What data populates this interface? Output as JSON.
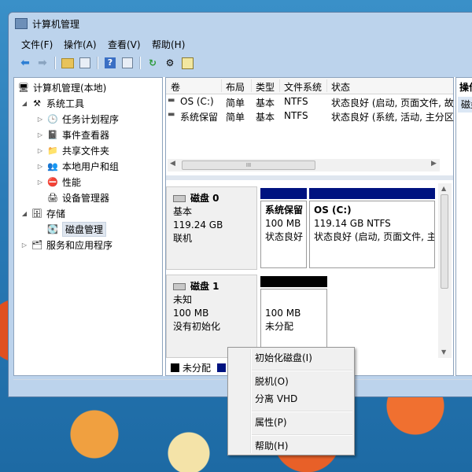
{
  "window": {
    "title": "计算机管理"
  },
  "menubar": [
    "文件(F)",
    "操作(A)",
    "查看(V)",
    "帮助(H)"
  ],
  "toolbar_icons": [
    "back-arrow-icon",
    "forward-arrow-icon",
    "up-folder-icon",
    "show-hide-tree-icon",
    "help-icon",
    "action-pane-icon",
    "refresh-icon",
    "properties-icon",
    "export-icon"
  ],
  "tree": {
    "root": "计算机管理(本地)",
    "system_tools": "系统工具",
    "task_scheduler": "任务计划程序",
    "event_viewer": "事件查看器",
    "shared_folders": "共享文件夹",
    "local_users": "本地用户和组",
    "performance": "性能",
    "device_manager": "设备管理器",
    "storage": "存储",
    "disk_management": "磁盘管理",
    "services_apps": "服务和应用程序"
  },
  "volume_list": {
    "columns": [
      "卷",
      "布局",
      "类型",
      "文件系统",
      "状态"
    ],
    "rows": [
      {
        "volume": "OS (C:)",
        "layout": "简单",
        "type": "基本",
        "fs": "NTFS",
        "status": "状态良好 (启动, 页面文件, 故"
      },
      {
        "volume": "系统保留",
        "layout": "简单",
        "type": "基本",
        "fs": "NTFS",
        "status": "状态良好 (系统, 活动, 主分区"
      }
    ],
    "hscroll_thumb": "III"
  },
  "disks": [
    {
      "name": "磁盘 0",
      "type": "基本",
      "size": "119.24 GB",
      "state": "联机",
      "partitions": [
        {
          "name": "系统保留",
          "size": "100 MB",
          "status": "状态良好"
        },
        {
          "name": "OS  (C:)",
          "size": "119.14 GB NTFS",
          "status": "状态良好 (启动, 页面文件, 主"
        }
      ]
    },
    {
      "name": "磁盘 1",
      "type": "未知",
      "size": "100 MB",
      "state": "没有初始化",
      "partitions": [
        {
          "name": "",
          "size": "100 MB",
          "status": "未分配"
        }
      ]
    }
  ],
  "legend": {
    "unallocated": "未分配"
  },
  "action_pane": {
    "title": "操作",
    "item": "磁盘"
  },
  "context_menu": {
    "initialize": "初始化磁盘(I)",
    "offline": "脱机(O)",
    "detach_vhd": "分离 VHD",
    "properties": "属性(P)",
    "help": "帮助(H)"
  },
  "colors": {
    "partition_header": "#001380",
    "unallocated": "#000000",
    "primary": "#001380"
  }
}
